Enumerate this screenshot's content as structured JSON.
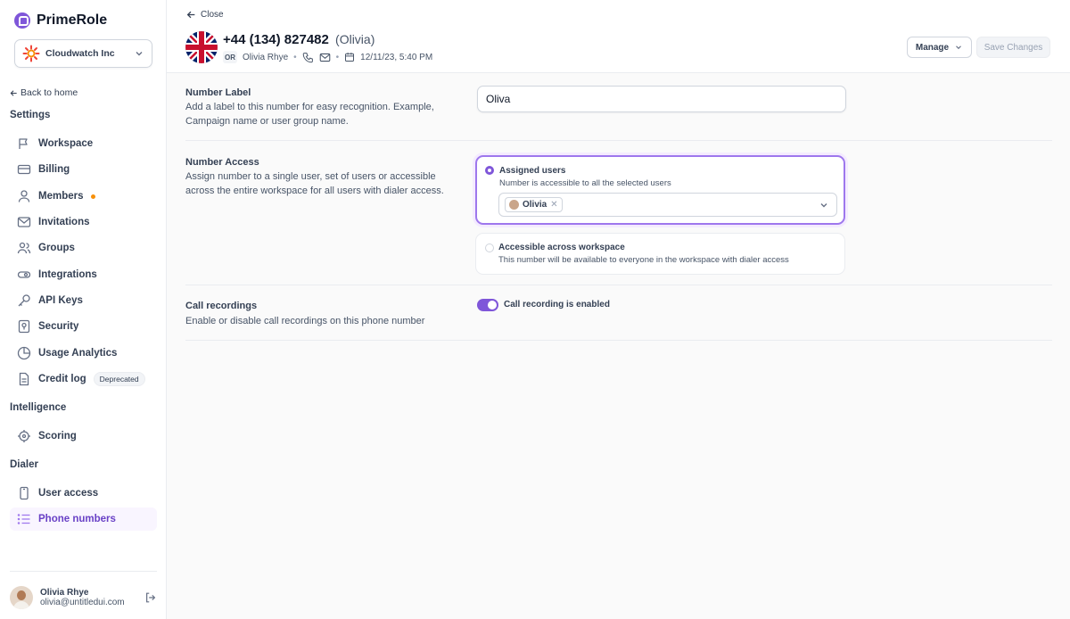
{
  "app": {
    "name": "PrimeRole"
  },
  "org": {
    "name": "Cloudwatch Inc"
  },
  "nav": {
    "back": "Back to home"
  },
  "sections": {
    "settings": "Settings",
    "intelligence": "Intelligence",
    "dialer": "Dialer"
  },
  "settings_items": [
    {
      "label": "Workspace",
      "icon": "flag-icon"
    },
    {
      "label": "Billing",
      "icon": "credit-card-icon"
    },
    {
      "label": "Members",
      "icon": "user-icon"
    },
    {
      "label": "Invitations",
      "icon": "mail-icon"
    },
    {
      "label": "Groups",
      "icon": "users-icon"
    },
    {
      "label": "Integrations",
      "icon": "link-icon"
    },
    {
      "label": "API Keys",
      "icon": "key-icon"
    },
    {
      "label": "Security",
      "icon": "shield-icon"
    },
    {
      "label": "Usage Analytics",
      "icon": "pie-chart-icon"
    },
    {
      "label": "Credit log",
      "icon": "file-icon",
      "badge": "Deprecated"
    }
  ],
  "intelligence_items": [
    {
      "label": "Scoring",
      "icon": "target-icon"
    }
  ],
  "dialer_items": [
    {
      "label": "User access",
      "icon": "phone-device-icon"
    },
    {
      "label": "Phone numbers",
      "icon": "list-icon",
      "active": true
    }
  ],
  "user": {
    "name": "Olivia Rhye",
    "email": "olivia@untitledui.com"
  },
  "header": {
    "close": "Close",
    "phone": "+44 (134) 827482",
    "phone_name": "(Olivia)",
    "owner_initials": "OR",
    "owner_name": "Olivia Rhye",
    "date": "12/11/23, 5:40 PM",
    "manage": "Manage",
    "save": "Save Changes"
  },
  "number_label": {
    "title": "Number Label",
    "desc": "Add a label to this number for easy recognition. Example, Campaign name or user group name.",
    "value": "Oliva"
  },
  "number_access": {
    "title": "Number Access",
    "desc": "Assign number to a single user, set of users or accessible across the entire workspace for all users with dialer access.",
    "assigned_title": "Assigned users",
    "assigned_desc": "Number is accessible to all the selected users",
    "selected_user": "Olivia",
    "workspace_title": "Accessible across workspace",
    "workspace_desc": "This number will be available to everyone in the workspace with dialer access"
  },
  "call_recordings": {
    "title": "Call recordings",
    "desc": "Enable or disable call recordings on this phone number",
    "toggle_label": "Call recording is enabled",
    "enabled": true
  },
  "colors": {
    "accent": "#7f56d9",
    "warning_dot": "#f79009"
  }
}
